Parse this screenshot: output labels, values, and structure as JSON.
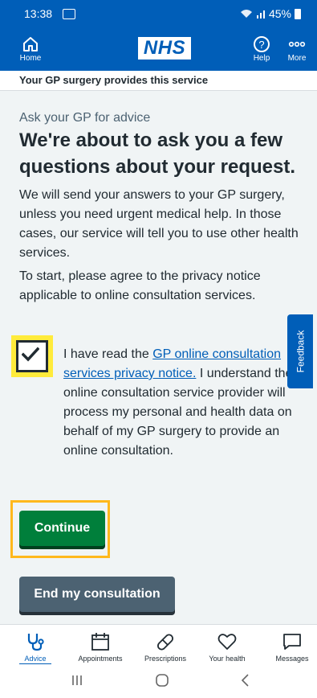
{
  "status_bar": {
    "time": "13:38",
    "battery": "45%"
  },
  "app_bar": {
    "home_label": "Home",
    "logo": "NHS",
    "help_label": "Help",
    "more_label": "More"
  },
  "banner": {
    "text": "Your GP surgery provides this service"
  },
  "main": {
    "caption": "Ask your GP for advice",
    "title": "We're about to ask you a few questions about your request.",
    "paragraph1": "We will send your answers to your GP surgery, unless you need urgent medical help. In those cases, our service will tell you to use other health services.",
    "paragraph2": "To start, please agree to the privacy notice applicable to online consultation services.",
    "checkbox": {
      "checked": true,
      "text_before": "I have read the ",
      "link": "GP online consultation services privacy notice.",
      "text_after": " I understand the online consultation service provider will process my personal and health data on behalf of my GP surgery to provide an online consultation."
    },
    "continue_label": "Continue",
    "end_label": "End my consultation",
    "feedback_label": "Feedback"
  },
  "bottom_tabs": [
    {
      "label": "Advice",
      "icon": "stethoscope-icon",
      "active": true
    },
    {
      "label": "Appointments",
      "icon": "calendar-icon",
      "active": false
    },
    {
      "label": "Prescriptions",
      "icon": "pill-icon",
      "active": false
    },
    {
      "label": "Your health",
      "icon": "heart-icon",
      "active": false
    },
    {
      "label": "Messages",
      "icon": "message-icon",
      "active": false
    }
  ],
  "colors": {
    "nhs_blue": "#005eb8",
    "continue_green": "#007f3b",
    "focus_yellow": "#ffeb3b",
    "secondary_grey": "#4c6272"
  }
}
